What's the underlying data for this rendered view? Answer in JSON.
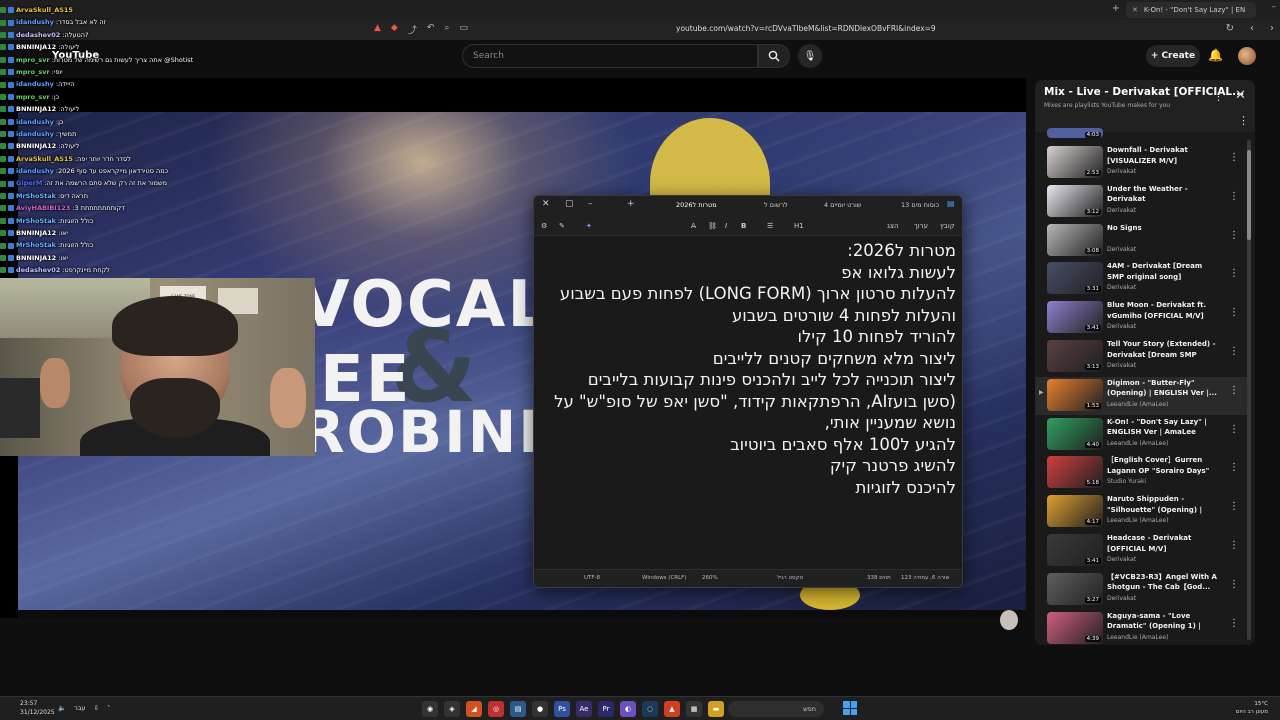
{
  "browser": {
    "tab_title": "K-On! - \"Don't Say Lazy\" | EN",
    "url": "youtube.com/watch?v=rcDVvaTIbeM&list=RDNDlexOBvFRI&index=9"
  },
  "youtube": {
    "logo": "YouTube",
    "search_placeholder": "Search",
    "create_label": "Create"
  },
  "chat": [
    {
      "user": "ArvaSkull_AS15",
      "msg": "",
      "color": "#e8c040"
    },
    {
      "user": "idandushy",
      "msg": ":זה לא אבל בסדר",
      "color": "#5aa0ff"
    },
    {
      "user": "dedashev02",
      "msg": ":הטעלה?",
      "color": "#c0c0ff"
    },
    {
      "user": "BNNINJA12",
      "msg": ":ליעולה",
      "color": "#ffffff"
    },
    {
      "user": "mpro_svr",
      "msg": ":אתה צריך לעשות גם רשימה של מטרות @Shotist",
      "color": "#6ad06a"
    },
    {
      "user": "mpro_svr",
      "msg": ":יופי",
      "color": "#6ad06a"
    },
    {
      "user": "idandushy",
      "msg": ":הייידה",
      "color": "#5aa0ff"
    },
    {
      "user": "mpro_svr",
      "msg": ":כן",
      "color": "#6ad06a"
    },
    {
      "user": "BNNINJA12",
      "msg": ":ליעולה",
      "color": "#ffffff"
    },
    {
      "user": "idandushy",
      "msg": ":כן",
      "color": "#5aa0ff"
    },
    {
      "user": "idandushy",
      "msg": ":תמשיך",
      "color": "#5aa0ff"
    },
    {
      "user": "BNNINJA12",
      "msg": ":ליעולה",
      "color": "#ffffff"
    },
    {
      "user": "ArvaSkull_AS15",
      "msg": ":לסדר חדר יותר יפה",
      "color": "#e8c040"
    },
    {
      "user": "idandushy",
      "msg": ":כמה סטירדאון מייקראפט עד סוף 2026",
      "color": "#5aa0ff"
    },
    {
      "user": "GiperM",
      "msg": ":משמור את זה רק שלא סתם הרשמה את זה",
      "color": "#4a6aff"
    },
    {
      "user": "MrShoStak",
      "msg": ":תראה דיס",
      "color": "#6ab0ff"
    },
    {
      "user": "AviyHABIBI123",
      "msg": ":דקותתתתתתתת 3",
      "color": "#d060d0"
    },
    {
      "user": "MrShoStak",
      "msg": ":כולל הזוגיות",
      "color": "#6ab0ff"
    },
    {
      "user": "BNNINJA12",
      "msg": ":יאו",
      "color": "#ffffff"
    },
    {
      "user": "MrShoStak",
      "msg": ":כולל הזוגיות",
      "color": "#6ab0ff"
    },
    {
      "user": "BNNINJA12",
      "msg": ":יאו",
      "color": "#ffffff"
    },
    {
      "user": "dedashev02",
      "msg": ":לקחת מיינקרפט",
      "color": "#c0c0ff"
    }
  ],
  "video_art": {
    "line1": "VOCALS",
    "line2": "EE",
    "line3": "ROBINET",
    "amp": "&",
    "poster": "GAME ZONE"
  },
  "notepad": {
    "tabs": [
      "13 כוסות מים",
      "שורט יומיים 4",
      "לרשום ל",
      "מטרות ל2026"
    ],
    "menu": [
      "קובץ",
      "ערוך",
      "הצג"
    ],
    "heading_label": "H1",
    "lines": [
      "מטרות ל2026:",
      "לעשות גלואו אפ",
      "להעלות סרטון ארוך (LONG FORM) לפחות פעם בשבוע",
      "והעלות לפחות 4 שורטים בשבוע",
      "להוריד לפחות 10 קילו",
      "ליצור מלא משחקים קטנים ללייבים",
      "ליצור תוכנייה לכל לייב ולהכניס פינות קבועות בלייבים",
      "(סשן בועזAI, הרפתקאות קידוד, \"סשן יאפ של סופ\"ש\" על",
      "נושא שמעניין אותי,",
      "להגיע ל100 אלף סאבים ביוטיוב",
      "להשיג פרטנר קיק",
      "להיכנס לזוגיות"
    ],
    "status": {
      "position": "שורה 6, עמודה 123",
      "chars": "338 תווים",
      "format": "טקסט רגיל",
      "zoom": "260%",
      "eol": "Windows (CRLF)",
      "encoding": "UTF-8"
    }
  },
  "playlist": {
    "title": "Mix - Live - Derivakat [OFFICIAL...",
    "subtitle": "Mixes are playlists YouTube makes for you",
    "top_duration": "4:03",
    "items": [
      {
        "title": "Downfall - Derivakat [VISUALIZER M/V]",
        "artist": "Derivakat",
        "duration": "2:53",
        "color": "#d8d0d0",
        "playing": false
      },
      {
        "title": "Under the Weather - Derivakat",
        "artist": "Derivakat",
        "duration": "3:12",
        "color": "#e8e8f0",
        "playing": false
      },
      {
        "title": "No Signs",
        "artist": "Derivakat",
        "duration": "3:08",
        "color": "#b8b8b8",
        "playing": false
      },
      {
        "title": "4AM - Derivakat [Dream SMP original song]",
        "artist": "Derivakat",
        "duration": "3:31",
        "color": "#485068",
        "playing": false
      },
      {
        "title": "Blue Moon - Derivakat ft. vGumiho [OFFICIAL M/V]",
        "artist": "Derivakat",
        "duration": "3:41",
        "color": "#9080d0",
        "playing": false
      },
      {
        "title": "Tell Your Story (Extended) - Derivakat [Dream SMP Origin...",
        "artist": "Derivakat",
        "duration": "3:13",
        "color": "#5a4040",
        "playing": false
      },
      {
        "title": "Digimon - \"Butter-Fly\" (Opening) | ENGLISH Ver |...",
        "artist": "LeeandLie (AmaLee)",
        "duration": "1:53",
        "color": "#e88030",
        "playing": true
      },
      {
        "title": "K-On! - \"Don't Say Lazy\" | ENGLISH Ver | AmaLee (feat....",
        "artist": "LeeandLie (AmaLee)",
        "duration": "4:40",
        "color": "#30a060",
        "playing": false
      },
      {
        "title": "［English Cover］Gurren Lagann OP \"Sorairo Days\" FUL...",
        "artist": "Studio Yuraki",
        "duration": "5:18",
        "color": "#d04040",
        "playing": false
      },
      {
        "title": "Naruto Shippuden - \"Silhouette\" (Opening) | ENGLISH Ver |...",
        "artist": "LeeandLie (AmaLee)",
        "duration": "4:17",
        "color": "#e0a030",
        "playing": false
      },
      {
        "title": "Headcase - Derivakat [OFFICIAL M/V]",
        "artist": "Derivakat",
        "duration": "3:41",
        "color": "#3a3a3a",
        "playing": false
      },
      {
        "title": "【#VCB23-R3】Angel With A Shotgun - The Cab【God...",
        "artist": "Derivakat",
        "duration": "3:27",
        "color": "#606060",
        "playing": false
      },
      {
        "title": "Kaguya-sama - \"Love Dramatic\" (Opening 1) | ENGLISH Ver |...",
        "artist": "LeeandLie (AmaLee)",
        "duration": "4:39",
        "color": "#d06080",
        "playing": false
      }
    ]
  },
  "taskbar": {
    "time": "23:57",
    "date": "31/12/2025",
    "lang": "עבר",
    "search_label": "חפש",
    "weather_temp": "15°C",
    "weather_desc": "מעונן רב היום"
  }
}
